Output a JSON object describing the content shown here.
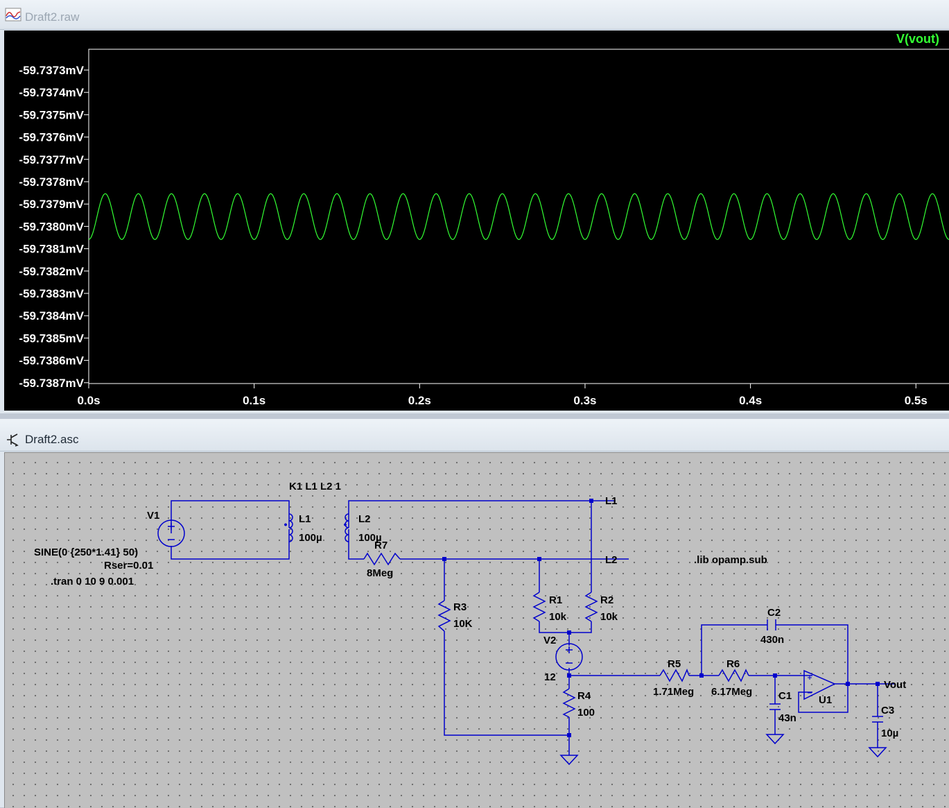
{
  "plot_window": {
    "title": "Draft2.raw",
    "icon": "waveform-icon",
    "trace_label": "V(vout)",
    "trace_color": "#33ff33"
  },
  "schematic_window": {
    "title": "Draft2.asc",
    "icon": "schematic-icon",
    "wire_color": "#0000cc",
    "labels": {
      "k1": "K1 L1 L2 1",
      "v1": "V1",
      "v1_value": "SINE(0 {250*1.41} 50)",
      "v1_rser": "Rser=0.01",
      "tran": ".tran 0 10 9 0.001",
      "l1": "L1",
      "l1_value": "100µ",
      "l2": "L2",
      "l2_value": "100µ",
      "r7": "R7",
      "r7_value": "8Meg",
      "net_l1": "L1",
      "net_l2": "L2",
      "lib": ".lib opamp.sub",
      "r3": "R3",
      "r3_value": "10K",
      "r1": "R1",
      "r1_value": "10k",
      "r2": "R2",
      "r2_value": "10k",
      "v2": "V2",
      "v2_value": "12",
      "r4": "R4",
      "r4_value": "100",
      "r5": "R5",
      "r5_value": "1.71Meg",
      "r6": "R6",
      "r6_value": "6.17Meg",
      "c2": "C2",
      "c2_value": "430n",
      "c1": "C1",
      "c1_value": "43n",
      "u1": "U1",
      "vout": "Vout",
      "c3": "C3",
      "c3_value": "10µ"
    }
  },
  "chart_data": {
    "type": "line",
    "title": "",
    "series": [
      {
        "name": "V(vout)",
        "signal": "sine",
        "frequency_hz": 50,
        "center_mV": -59.73795,
        "amplitude_mV": 0.0001,
        "phase": "starts at trough"
      }
    ],
    "x_ticks": [
      "0.0s",
      "0.1s",
      "0.2s",
      "0.3s",
      "0.4s",
      "0.5s"
    ],
    "xlim": [
      0,
      0.52
    ],
    "y_ticks": [
      "-59.7373mV",
      "-59.7374mV",
      "-59.7375mV",
      "-59.7376mV",
      "-59.7377mV",
      "-59.7378mV",
      "-59.7379mV",
      "-59.7380mV",
      "-59.7381mV",
      "-59.7382mV",
      "-59.7383mV",
      "-59.7384mV",
      "-59.7385mV",
      "-59.7386mV",
      "-59.7387mV"
    ],
    "ylim": [
      -59.7387,
      -59.7373
    ],
    "grid": false,
    "legend": "top-right"
  }
}
